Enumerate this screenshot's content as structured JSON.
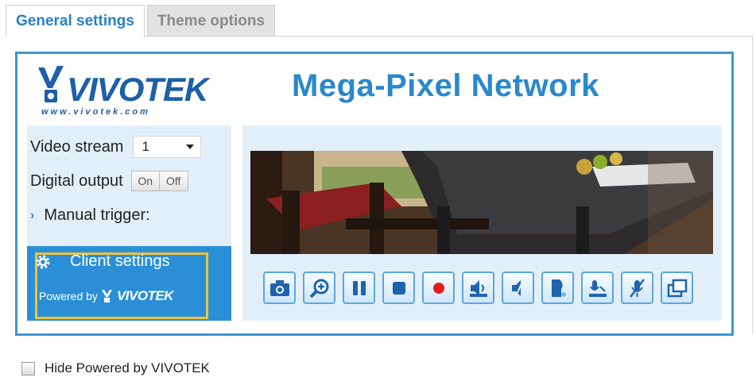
{
  "tabs": [
    {
      "label": "General settings",
      "active": true
    },
    {
      "label": "Theme options",
      "active": false
    }
  ],
  "logo": {
    "word": "VIVOTEK",
    "url": "www.vivotek.com"
  },
  "page_title": "Mega-Pixel Network",
  "controls": {
    "video_stream_label": "Video stream",
    "video_stream_value": "1",
    "digital_output_label": "Digital output",
    "on_label": "On",
    "off_label": "Off",
    "manual_trigger_label": "Manual trigger:"
  },
  "client": {
    "label": "Client settings",
    "powered_by": "Powered by",
    "powered_logo": "VIVOTEK"
  },
  "toolbar_icons": [
    "camera-icon",
    "zoom-icon",
    "pause-icon",
    "stop-icon",
    "record-icon",
    "volume-icon",
    "mute-icon",
    "talk-icon",
    "mic-icon",
    "mic-mute-icon",
    "fullscreen-icon"
  ],
  "footer": {
    "checkbox_label": "Hide Powered by VIVOTEK",
    "checked": false
  },
  "colors": {
    "accent": "#2a8fd6",
    "frame": "#3c97cf",
    "highlight": "#f0c23a",
    "panel": "#e3eff8"
  }
}
